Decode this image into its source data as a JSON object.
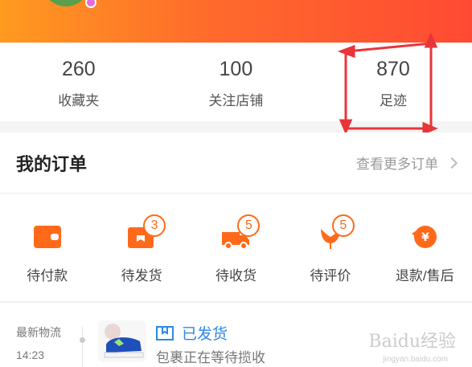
{
  "colors": {
    "brand_orange": "#ff6a1a",
    "header_start": "#ff9a1f",
    "header_end": "#ff4a33",
    "status_blue": "#2a8ae6",
    "annotation_red": "#e8353a"
  },
  "stats": [
    {
      "value": "260",
      "label": "收藏夹"
    },
    {
      "value": "100",
      "label": "关注店铺"
    },
    {
      "value": "870",
      "label": "足迹"
    }
  ],
  "orders": {
    "title": "我的订单",
    "more_link": "查看更多订单",
    "items": [
      {
        "label": "待付款",
        "icon": "wallet-icon",
        "badge": ""
      },
      {
        "label": "待发货",
        "icon": "package-icon",
        "badge": "3"
      },
      {
        "label": "待收货",
        "icon": "truck-icon",
        "badge": "5"
      },
      {
        "label": "待评价",
        "icon": "flower-icon",
        "badge": "5"
      },
      {
        "label": "退款/售后",
        "icon": "refund-icon",
        "badge": ""
      }
    ]
  },
  "logistics": {
    "tag": "最新物流",
    "time": "14:23",
    "status": "已发货",
    "description": "包裹正在等待揽收"
  },
  "watermark": {
    "text": "Baidu经验",
    "sub": "jingyan.baidu.com"
  }
}
